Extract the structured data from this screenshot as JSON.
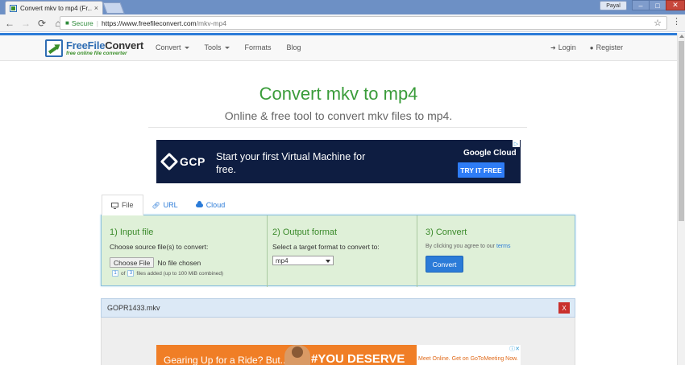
{
  "browser": {
    "tab_title": "Convert mkv to mp4 (Fr...",
    "tab_close": "×",
    "profile_name": "Payal",
    "win_min": "–",
    "win_max": "□",
    "win_close": "✕",
    "back": "←",
    "forward": "→",
    "reload": "⟳",
    "home": "⌂",
    "secure_label": "Secure",
    "url_sep": "|",
    "url_main": "https://www.freefileconvert.com",
    "url_path": "/mkv-mp4",
    "star": "☆",
    "menu": "⋮"
  },
  "site": {
    "logo_prefix": "FreeFile",
    "logo_suffix": "Convert",
    "logo_tagline": "free online file converter",
    "nav": {
      "convert": "Convert",
      "tools": "Tools",
      "formats": "Formats",
      "blog": "Blog"
    },
    "login": "Login",
    "register": "Register"
  },
  "hero": {
    "title": "Convert mkv to mp4",
    "subtitle": "Online & free tool to convert mkv files to mp4."
  },
  "ad_top": {
    "logo_text": "GCP",
    "headline": "Start your first Virtual Machine for free.",
    "brand": "Google Cloud",
    "cta": "TRY IT FREE",
    "choice": "▷"
  },
  "tabs": {
    "file": "File",
    "url": "URL",
    "cloud": "Cloud"
  },
  "panel": {
    "step1": {
      "title": "1) Input file",
      "label": "Choose source file(s) to convert:",
      "button": "Choose File",
      "no_file": "No file chosen",
      "count_current": "1",
      "count_of": "of",
      "count_max": "3",
      "count_suffix": "files added (up to 100 MiB combined)"
    },
    "step2": {
      "title": "2) Output format",
      "label": "Select a target format to convert to:",
      "selected": "mp4"
    },
    "step3": {
      "title": "3) Convert",
      "agree_prefix": "By clicking you agree to our",
      "terms": "terms",
      "button": "Convert"
    }
  },
  "file_list": {
    "filename": "GOPR1433.mkv",
    "remove": "X"
  },
  "ad_bottom": {
    "headline": "Gearing Up for a Ride? But...",
    "tagline": "#YOU DESERVE",
    "offer": "Meet Online. Get on GoToMeeting Now.",
    "choice": "ⓘ✕"
  },
  "colors": {
    "brand_green": "#3a9c3a",
    "link_blue": "#2b7bd8",
    "panel_green": "#dff0d8",
    "remove_red": "#c9302c"
  }
}
